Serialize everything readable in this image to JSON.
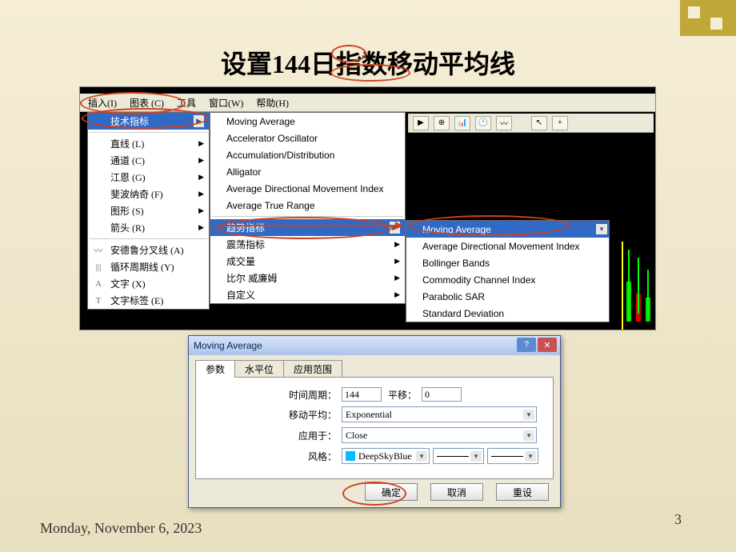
{
  "slide": {
    "title": "设置144日指数移动平均线",
    "date": "Monday, November 6, 2023",
    "page": "3"
  },
  "menubar": {
    "insert": "插入(I)",
    "chart": "图表 (C)",
    "tools": "工具",
    "window": "窗口(W)",
    "help": "帮助(H)"
  },
  "dd1": {
    "tech": "技术指标",
    "line": "直线 (L)",
    "channel": "通道 (C)",
    "gann": "江恩 (G)",
    "fib": "斐波纳奇 (F)",
    "shape": "图形 (S)",
    "arrow": "箭头 (R)",
    "andrews": "安德鲁分叉线 (A)",
    "cycle": "循环周期线 (Y)",
    "text": "文字 (X)",
    "label": "文字标签 (E)"
  },
  "dd2": {
    "ma": "Moving Average",
    "ao": "Accelerator Oscillator",
    "ad": "Accumulation/Distribution",
    "alligator": "Alligator",
    "adx": "Average Directional Movement Index",
    "atr": "Average True Range",
    "trend": "趋势指标",
    "osc": "震荡指标",
    "vol": "成交量",
    "bill": "比尔 威廉姆",
    "custom": "自定义"
  },
  "dd3": {
    "ma": "Moving Average",
    "adx": "Average Directional Movement Index",
    "bb": "Bollinger Bands",
    "cci": "Commodity Channel Index",
    "sar": "Parabolic SAR",
    "sd": "Standard Deviation"
  },
  "dialog": {
    "title": "Moving Average",
    "tab_params": "参数",
    "tab_levels": "水平位",
    "tab_apply": "应用范围",
    "period_label": "时间周期：",
    "period_value": "144",
    "shift_label": "平移：",
    "shift_value": "0",
    "method_label": "移动平均：",
    "method_value": "Exponential",
    "apply_label": "应用于：",
    "apply_value": "Close",
    "style_label": "风格：",
    "style_color": "DeepSkyBlue",
    "ok": "确定",
    "cancel": "取消",
    "reset": "重设"
  }
}
